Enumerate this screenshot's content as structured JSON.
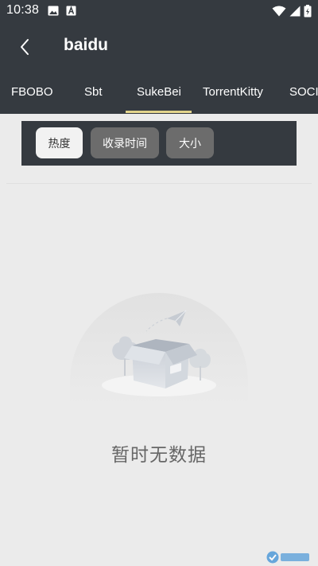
{
  "status_bar": {
    "time": "10:38",
    "icons": [
      "image-icon",
      "a-letter-icon",
      "wifi-icon",
      "signal-icon",
      "battery-charging-icon"
    ]
  },
  "app_bar": {
    "title": "baidu",
    "back_icon": "chevron-left-icon"
  },
  "tabs": [
    {
      "label": "FBOBO",
      "selected": false
    },
    {
      "label": "Sbt",
      "selected": false
    },
    {
      "label": "SukeBei",
      "selected": true
    },
    {
      "label": "TorrentKitty",
      "selected": false
    },
    {
      "label": "SOCI",
      "selected": false
    }
  ],
  "sort_options": [
    {
      "label": "热度",
      "selected": true
    },
    {
      "label": "收录时间",
      "selected": false
    },
    {
      "label": "大小",
      "selected": false
    }
  ],
  "empty_state": {
    "message": "暂时无数据",
    "illustration": "empty-box-illustration"
  },
  "colors": {
    "header_bg": "#353a40",
    "tab_indicator": "#e2d48c",
    "page_bg": "#ebebeb",
    "chip_active_bg": "#f2f2f2",
    "chip_inactive_bg": "#6c6c6c"
  }
}
